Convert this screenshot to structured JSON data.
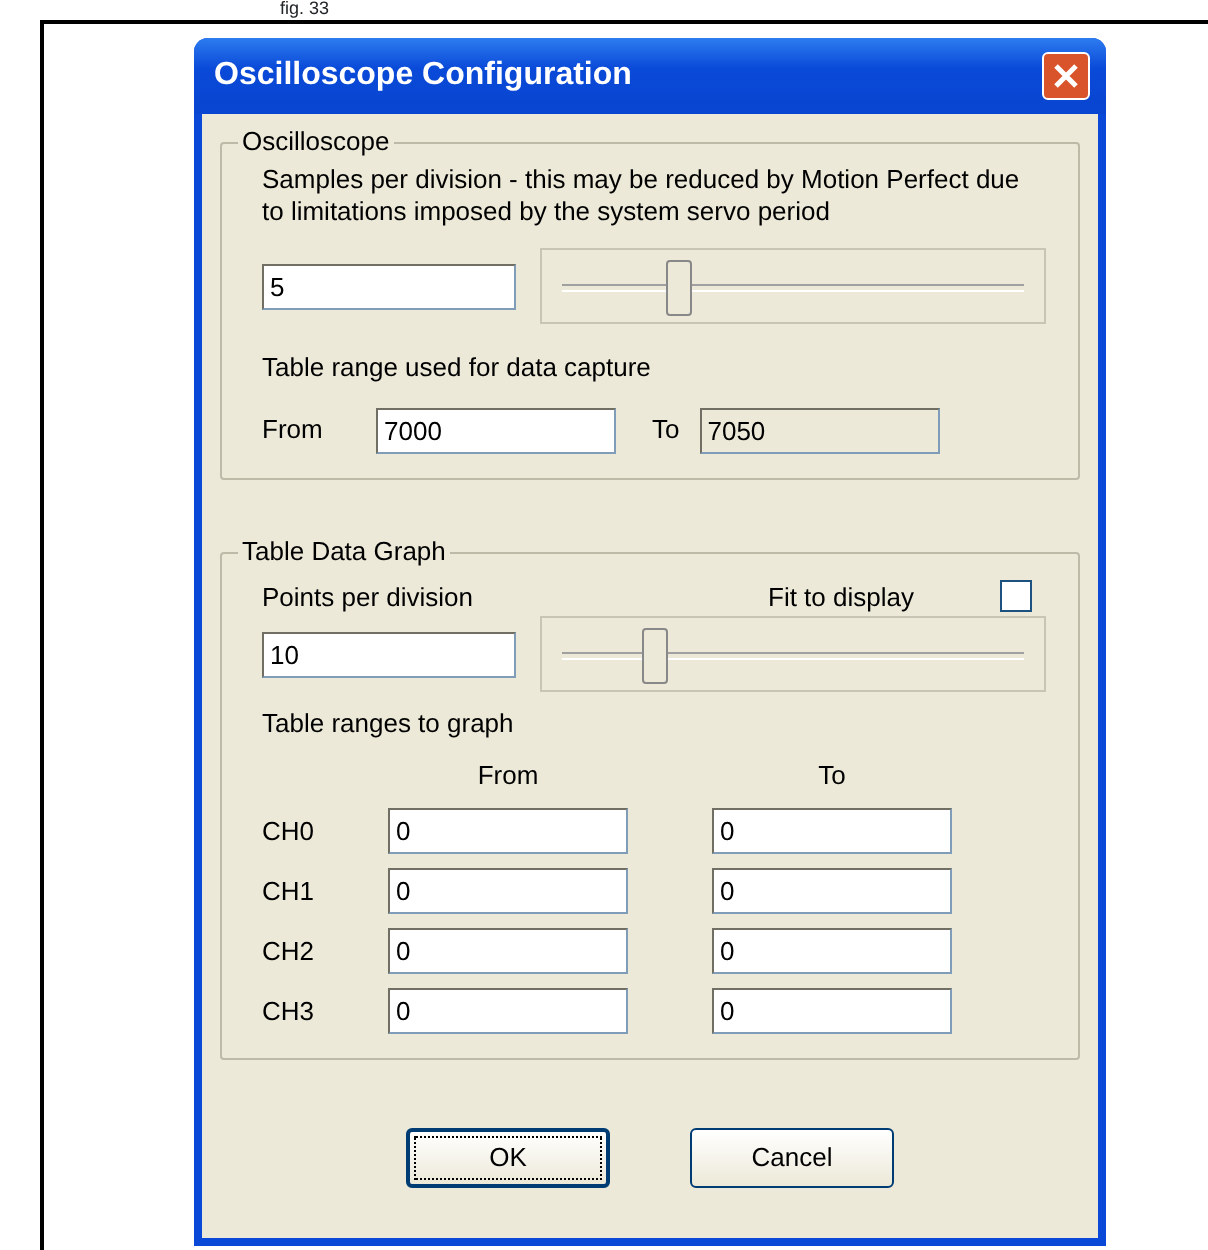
{
  "caption": "fig. 33",
  "window": {
    "title": "Oscilloscope Configuration"
  },
  "oscilloscope": {
    "legend": "Oscilloscope",
    "description": "Samples per division - this may be reduced by Motion Perfect due to limitations imposed by the system servo period",
    "samples_value": "5",
    "slider": {
      "level": 0.25
    },
    "range_label": "Table range used for data capture",
    "from": {
      "label": "From",
      "value": "7000",
      "disabled": false
    },
    "to": {
      "label": "To",
      "value": "7050",
      "disabled": true
    }
  },
  "table_data_graph": {
    "legend": "Table Data Graph",
    "points_label": "Points per division",
    "fit_label": "Fit to display",
    "fit_checked": false,
    "points_value": "10",
    "slider": {
      "level": 0.2
    },
    "ranges_label": "Table ranges to graph",
    "from_header": "From",
    "to_header": "To",
    "channels": [
      {
        "name": "CH0",
        "from": "0",
        "to": "0"
      },
      {
        "name": "CH1",
        "from": "0",
        "to": "0"
      },
      {
        "name": "CH2",
        "from": "0",
        "to": "0"
      },
      {
        "name": "CH3",
        "from": "0",
        "to": "0"
      }
    ]
  },
  "buttons": [
    {
      "label": "OK",
      "focused": true
    },
    {
      "label": "Cancel",
      "focused": false
    }
  ]
}
